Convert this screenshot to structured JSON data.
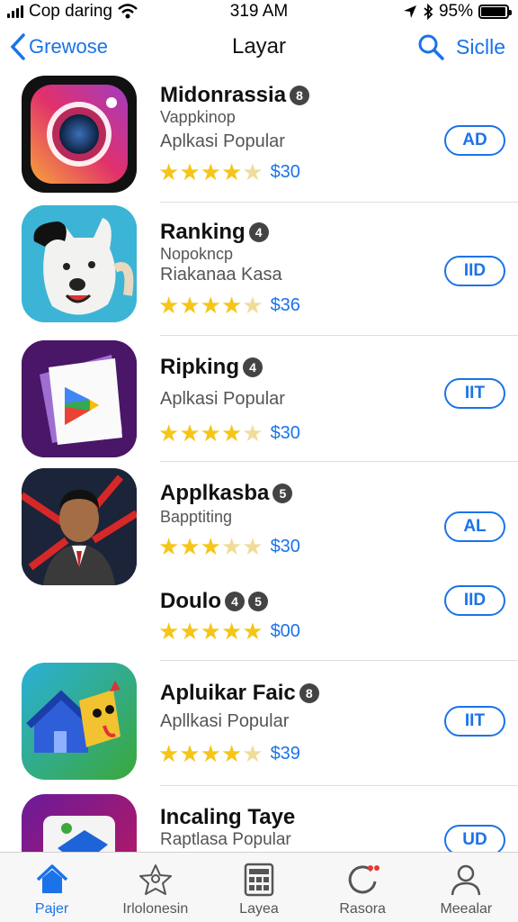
{
  "status_bar": {
    "carrier": "Cop daring",
    "time": "319 AM",
    "battery": "95%",
    "battery_level": 0.95
  },
  "nav": {
    "back_label": "Grewose",
    "title": "Layar",
    "right_label": "Siclle"
  },
  "apps": [
    {
      "name": "Midonrassia",
      "badge": "8",
      "subtitle": "Vappkinop",
      "category": "Aplkasi Popular",
      "rating": 4.5,
      "price": "$30",
      "button": "AD"
    },
    {
      "name": "Ranking",
      "badge": "4",
      "subtitle": "Nopokncp",
      "category": "Riakanaa Kasa",
      "rating": 4.5,
      "price": "$36",
      "button": "IID"
    },
    {
      "name": "Ripking",
      "badge": "4",
      "subtitle": "",
      "category": "Aplkasi Popular",
      "rating": 4.5,
      "price": "$30",
      "button": "IIT"
    },
    {
      "name": "Applkasba",
      "badge": "5",
      "subtitle": "Bapptiting",
      "category": "",
      "rating": 3.5,
      "price": "$30",
      "button": "AL"
    },
    {
      "name": "Doulo",
      "badge": "4",
      "badge2": "5",
      "subtitle": "",
      "category": "",
      "rating": 5,
      "price": "$00",
      "button": "IID"
    },
    {
      "name": "Apluikar Faic",
      "badge": "8",
      "subtitle": "",
      "category": "Apllkasi Popular",
      "rating": 4.5,
      "price": "$39",
      "button": "IIT"
    },
    {
      "name": "Incaling Taye",
      "badge": "",
      "subtitle": "",
      "category": "Raptlasa Popular",
      "rating": 0,
      "price": "",
      "button": "UD"
    }
  ],
  "tabs": [
    {
      "label": "Pajer",
      "icon": "home-icon",
      "active": true
    },
    {
      "label": "Irlolonesin",
      "icon": "star-figure-icon",
      "active": false
    },
    {
      "label": "Layea",
      "icon": "grid-icon",
      "active": false
    },
    {
      "label": "Rasora",
      "icon": "refresh-icon",
      "active": false
    },
    {
      "label": "Meealar",
      "icon": "person-icon",
      "active": false
    }
  ],
  "colors": {
    "accent": "#1a73e8",
    "star": "#f5c518"
  }
}
